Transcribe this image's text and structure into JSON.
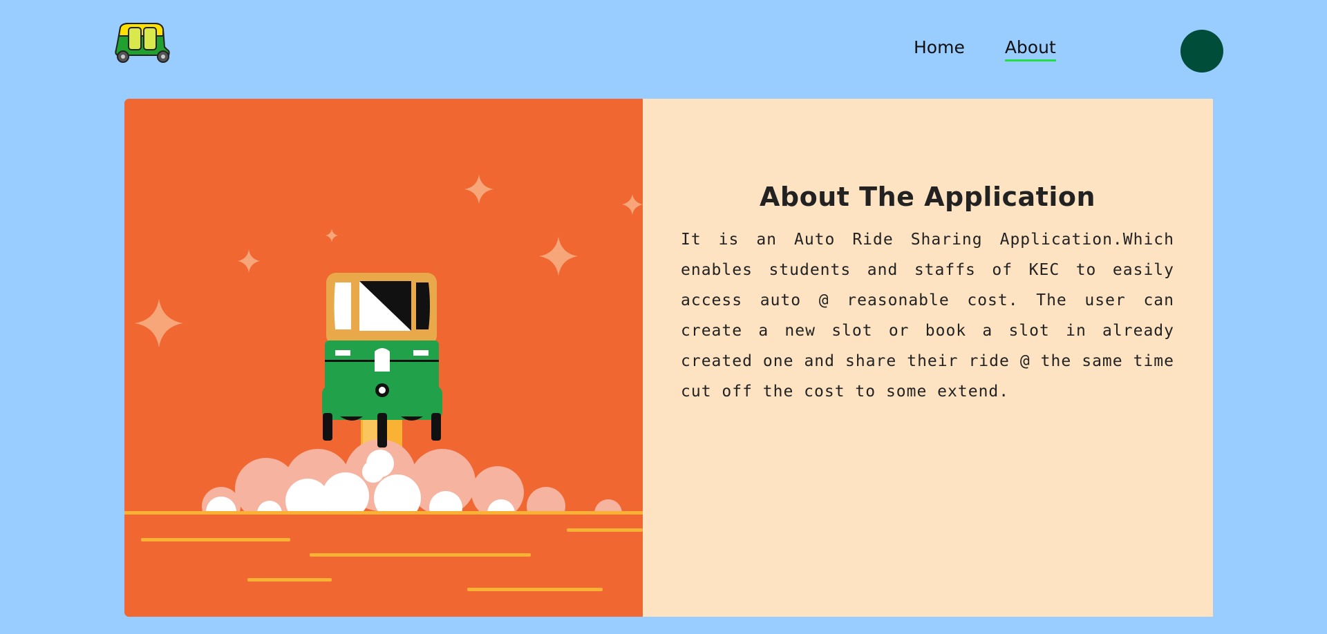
{
  "nav": {
    "logo_icon": "auto-rickshaw-icon",
    "links": [
      {
        "label": "Home",
        "active": false
      },
      {
        "label": "About",
        "active": true
      }
    ],
    "avatar_color": "#004d3a"
  },
  "about": {
    "illustration_icon": "auto-rickshaw-launch-illustration",
    "title": "About The Application",
    "description": "It is an Auto Ride Sharing Application.Which enables students and staffs of KEC to easily access auto @ reasonable cost. The user can create a new slot or book a slot in already created one and share their ride @ the same time cut off the cost to some extend."
  },
  "colors": {
    "page_background": "#99ccff",
    "illustration_background": "#f06732",
    "content_background": "#fee3c2",
    "active_underline": "#22dd44"
  }
}
